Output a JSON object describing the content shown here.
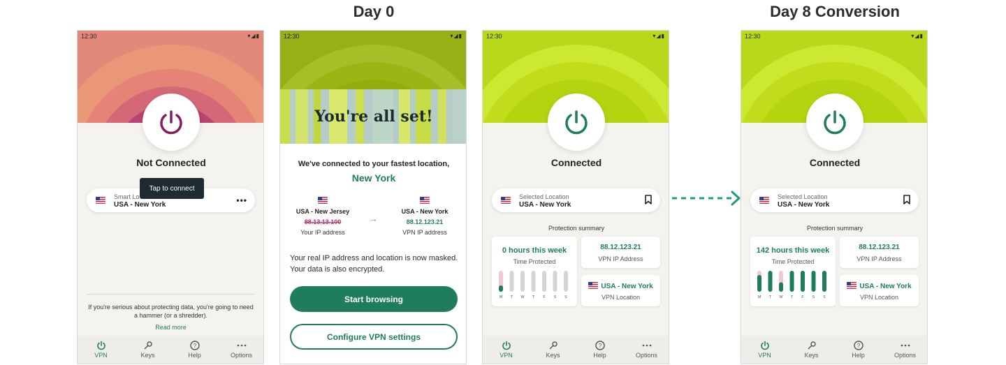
{
  "headings": {
    "day0": "Day 0",
    "day8": "Day 8 Conversion"
  },
  "status_time": "12:30",
  "nav": {
    "vpn": "VPN",
    "keys": "Keys",
    "help": "Help",
    "options": "Options"
  },
  "screen1": {
    "status": "Not Connected",
    "tooltip": "Tap to connect",
    "location_small": "Smart Lo",
    "location_main": "USA - New York",
    "promo_text": "If you're serious about protecting data, you're going to need a hammer (or a shredder).",
    "read_more": "Read more"
  },
  "screen2": {
    "banner_title": "You're all set!",
    "subtitle": "We've connected to your fastest location,",
    "city": "New York",
    "from_location": "USA - New Jersey",
    "from_ip": "88.13.13.100",
    "from_label": "Your IP address",
    "to_location": "USA - New York",
    "to_ip": "88.12.123.21",
    "to_label": "VPN IP address",
    "masked_text": "Your real IP address and location is now masked. Your data is also encrypted.",
    "start_button": "Start browsing",
    "configure_button": "Configure VPN settings"
  },
  "connected_screens": [
    {
      "status": "Connected",
      "location_small": "Selected Location",
      "location_main": "USA - New York",
      "summary_title": "Protection summary",
      "time_value": "0 hours this week",
      "time_label": "Time Protected",
      "ip_value": "88.12.123.21",
      "ip_label": "VPN IP Address",
      "vpn_location_value": "USA - New York",
      "vpn_location_label": "VPN Location",
      "day_labels": [
        "M",
        "T",
        "W",
        "T",
        "F",
        "S",
        "S"
      ],
      "daily_fill": [
        0.3,
        0,
        0,
        0,
        0,
        0,
        0
      ],
      "bar_states": [
        "today",
        "future",
        "future",
        "future",
        "future",
        "future",
        "future"
      ]
    },
    {
      "status": "Connected",
      "location_small": "Selected Location",
      "location_main": "USA - New York",
      "summary_title": "Protection summary",
      "time_value": "142 hours this week",
      "time_label": "Time Protected",
      "ip_value": "88.12.123.21",
      "ip_label": "VPN IP Address",
      "vpn_location_value": "USA - New York",
      "vpn_location_label": "VPN Location",
      "day_labels": [
        "M",
        "T",
        "W",
        "T",
        "F",
        "S",
        "S"
      ],
      "daily_fill": [
        0.8,
        1,
        0.45,
        1,
        1,
        1,
        1
      ],
      "bar_states": [
        "past",
        "past",
        "past",
        "past",
        "past",
        "past",
        "past"
      ]
    }
  ],
  "colors": {
    "accent_green": "#1f7d5e",
    "disconnected_accent": "#8a1a5e",
    "lime": "#b9d914",
    "pink": "#f0c8cf",
    "bar_grey": "#d1d5d8"
  }
}
